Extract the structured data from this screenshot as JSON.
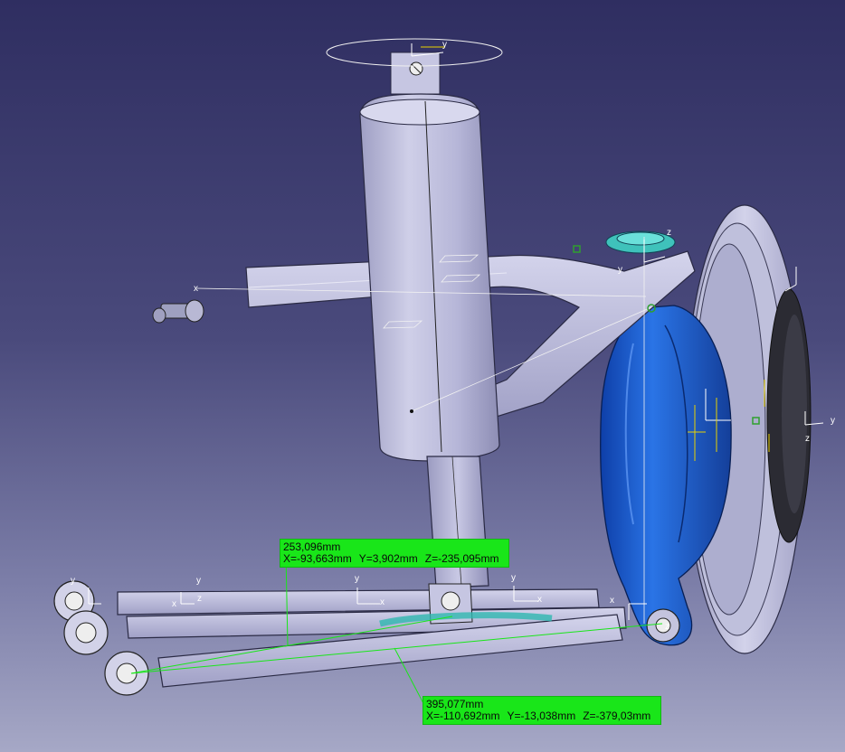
{
  "viewport": {
    "background_top": "#2f2e61",
    "background_bottom": "#a6a8c6"
  },
  "colors": {
    "part_grey": "#b8b8d6",
    "part_shadow": "#8d8db0",
    "knuckle_blue": "#1a5fd0",
    "measure_green": "#19e619",
    "axis_white": "#ffffff",
    "axis_yellow": "#e8d200",
    "constraint_green": "#2fa02f",
    "seat_cyan": "#2fb8b0"
  },
  "measurements": [
    {
      "distance": "253,096mm",
      "x": "X=-93,663mm",
      "y": "Y=3,902mm",
      "z": "Z=-235,095mm"
    },
    {
      "distance": "395,077mm",
      "x": "X=-110,692mm",
      "y": "Y=-13,038mm",
      "z": "Z=-379,03mm"
    }
  ],
  "axis_labels": {
    "x": "x",
    "y": "y",
    "z": "z"
  }
}
